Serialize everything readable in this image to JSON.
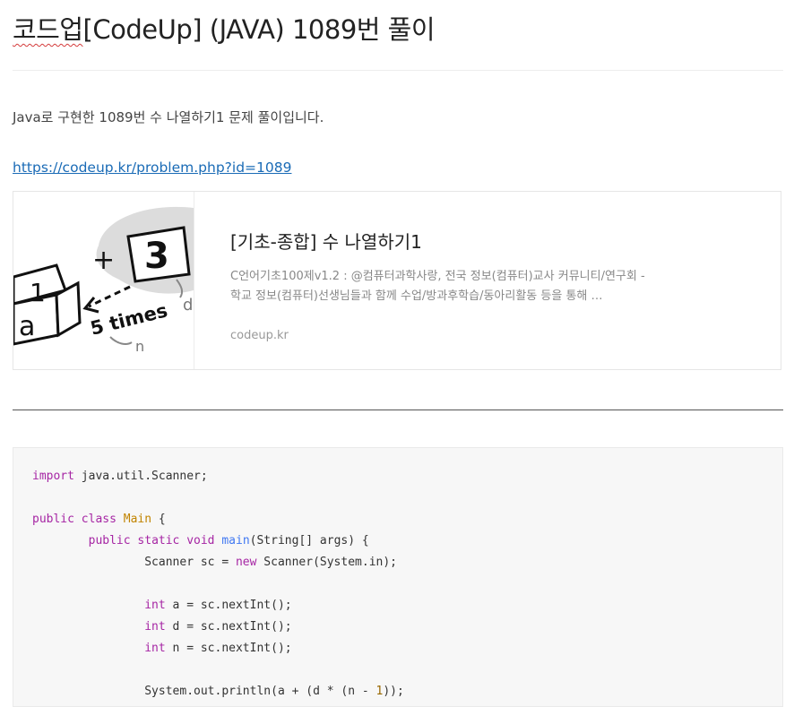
{
  "post": {
    "title_spell": "코드업",
    "title_rest": "[CodeUp] (JAVA) 1089번 풀이",
    "intro": "Java로 구현한 1089번 수 나열하기1 문제 풀이입니다.",
    "link": "https://codeup.kr/problem.php?id=1089"
  },
  "card": {
    "title": "[기초-종합] 수 나열하기1",
    "desc": "C언어기초100제v1.2 : @컴퓨터과학사랑, 전국 정보(컴퓨터)교사 커뮤니티/연구회 - 학교 정보(컴퓨터)선생님들과 함께 수업/방과후학습/동아리활동 등을 통해 …",
    "domain": "codeup.kr",
    "thumb": {
      "box_top": "1",
      "box_side": "a",
      "plus": "+",
      "target": "3",
      "times": "5 times",
      "d": "d",
      "n": "n"
    }
  },
  "code": {
    "line1_kw": "import",
    "line1_rest": " java.util.Scanner;",
    "line3_kw": "public class",
    "line3_cls": "Main",
    "line3_rest": " {",
    "line4_kw": "public static void",
    "line4_fn": "main",
    "line4_rest": "(String[] args) {",
    "line5_a": "Scanner sc = ",
    "line5_kw": "new",
    "line5_b": " Scanner(System.in);",
    "line7_kw": "int",
    "line7_rest": " a = sc.nextInt();",
    "line8_kw": "int",
    "line8_rest": " d = sc.nextInt();",
    "line9_kw": "int",
    "line9_rest": " n = sc.nextInt();",
    "line11_a": "System.out.println(a + (d * (n - ",
    "line11_num": "1",
    "line11_b": "));"
  },
  "colors": {
    "link": "#1a6bb6",
    "keyword": "#a626a4",
    "class_name": "#c18401",
    "function": "#4078f2",
    "number": "#986801"
  }
}
